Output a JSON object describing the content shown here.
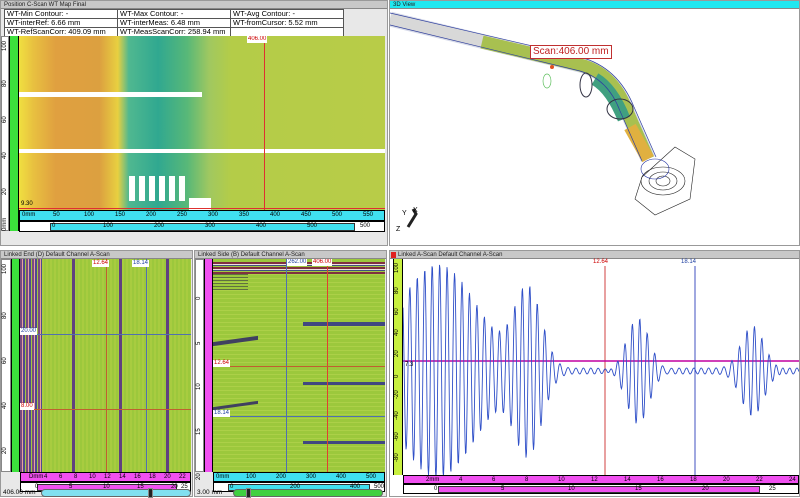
{
  "cscan": {
    "title": "Position C-Scan WT Map Final",
    "table": [
      [
        "WT-Min Contour: -",
        "WT-Max Contour: -",
        "WT-Avg Contour: -"
      ],
      [
        "WT-interRef: 6.66 mm",
        "WT-interMeas: 6.48 mm",
        "WT-fromCursor: 5.52 mm"
      ],
      [
        "WT-RefScanCorr: 409.09 mm",
        "WT-MeasScanCorr: 258.94 mm",
        ""
      ]
    ],
    "scan_cursor": "406.00",
    "index_cursor": "9.30",
    "vticks": [
      "100",
      "80",
      "60",
      "40",
      "20",
      "0mm"
    ],
    "hticks": [
      "0mm",
      "50",
      "100",
      "150",
      "200",
      "250",
      "300",
      "350",
      "400",
      "450",
      "500",
      "550"
    ],
    "range_ticks": [
      "0",
      "100",
      "200",
      "300",
      "400",
      "500"
    ],
    "range_end": "500"
  },
  "end": {
    "title": "Linked End (D) Default Channel A-Scan",
    "cursor_red": "12.64",
    "cursor_blue": "18.14",
    "hcursor_blue": "20.00",
    "hcursor_red": "8.00",
    "vticks": [
      "100",
      "80",
      "60",
      "40",
      "20"
    ],
    "hticks": [
      "Dmm",
      "4",
      "6",
      "8",
      "10",
      "12",
      "14",
      "16",
      "18",
      "20",
      "22"
    ],
    "range_ticks": [
      "0",
      "5",
      "10",
      "15",
      "20"
    ],
    "range_end": "25",
    "position": "406.00 mm",
    "slider_value": 0.73
  },
  "side": {
    "title": "Linked Side (B) Default Channel A-Scan",
    "cursor_blue": "262.00",
    "cursor_red": "406.00",
    "hcursor_red": "12.64",
    "hcursor_blue": "18.14",
    "vticks": [
      "0",
      "5",
      "10",
      "15",
      "20"
    ],
    "hticks": [
      "0mm",
      "100",
      "200",
      "300",
      "400",
      "500"
    ],
    "range_ticks": [
      "0",
      "200",
      "400"
    ],
    "range_end": "500",
    "position": "3.00 mm",
    "slider_value": 0.08
  },
  "view3d": {
    "title": "3D View",
    "scan_label": "Scan:406.00 mm",
    "axes": [
      "Y",
      "X",
      "Z"
    ]
  },
  "ascan": {
    "title": "Linked A-Scan Default Channel A-Scan",
    "cursor_red": "12.64",
    "cursor_blue": "18.14",
    "gate_label": "7.3",
    "vticks": [
      "100",
      "80",
      "60",
      "40",
      "20",
      "0",
      "-20",
      "-40",
      "-60",
      "-80"
    ],
    "hticks": [
      "2mm",
      "4",
      "6",
      "8",
      "10",
      "12",
      "14",
      "16",
      "18",
      "20",
      "22",
      "24"
    ],
    "range_ticks": [
      "0",
      "5",
      "10",
      "15",
      "20"
    ],
    "range_end": "25",
    "waveform_color": "#3050c8",
    "gate_color": "#c000a0"
  },
  "colors": {
    "cyan": "#40e0f0",
    "magenta": "#f050f0",
    "green": "#3ce03c",
    "scan_green": "#9cc83c",
    "red_cursor": "#e03030",
    "blue_cursor": "#4060c0"
  }
}
